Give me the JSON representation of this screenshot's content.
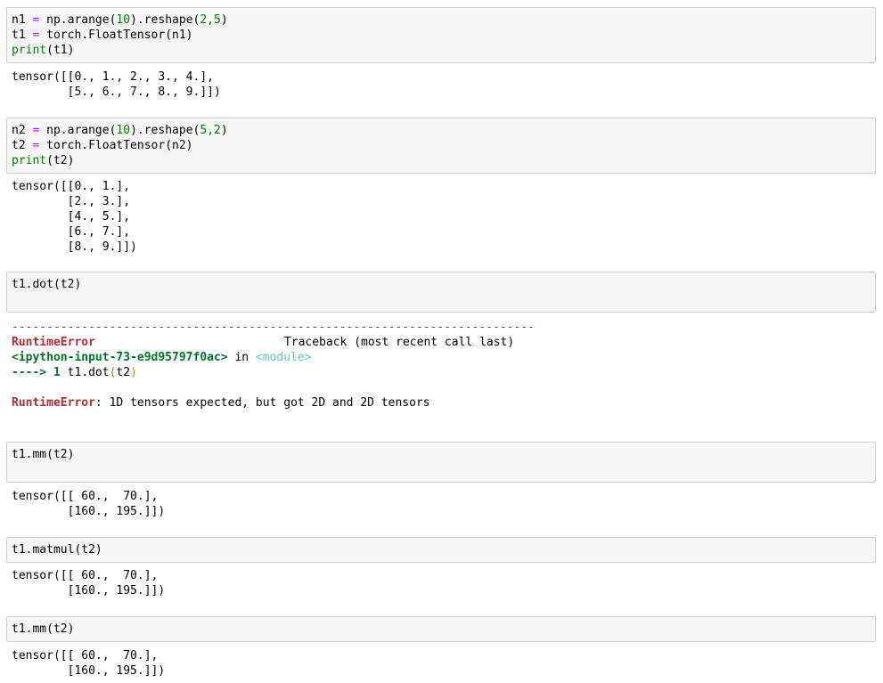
{
  "cells": [
    {
      "input": [
        {
          "a": "n1",
          "op": "=",
          "b": "np.arange(",
          "num1": "10",
          "c": ").reshape(",
          "num2": "2,5",
          "d": ")"
        },
        {
          "a": "t1",
          "op": "=",
          "b": "torch.FloatTensor(n1)"
        },
        {
          "fn": "print",
          "rest": "(t1)"
        }
      ],
      "output": [
        "tensor([[0., 1., 2., 3., 4.],",
        "        [5., 6., 7., 8., 9.]])"
      ]
    },
    {
      "input": [
        {
          "a": "n2",
          "op": "=",
          "b": "np.arange(",
          "num1": "10",
          "c": ").reshape(",
          "num2": "5,2",
          "d": ")"
        },
        {
          "a": "t2",
          "op": "=",
          "b": "torch.FloatTensor(n2)"
        },
        {
          "fn": "print",
          "rest": "(t2)"
        }
      ],
      "output": [
        "tensor([[0., 1.],",
        "        [2., 3.],",
        "        [4., 5.],",
        "        [6., 7.],",
        "        [8., 9.]])"
      ]
    },
    {
      "input": [
        "t1.dot(t2)"
      ],
      "error": {
        "dashes": "---------------------------------------------------------------------------",
        "name": "RuntimeError",
        "traceback_label": "Traceback (most recent call last)",
        "ipython_input": "<ipython-input-73-e9d95797f0ac>",
        "in": "in",
        "module": "<module>",
        "arrow": "----> 1",
        "code_prefix": "t1.dot",
        "code_paren_open": "(",
        "code_arg": "t2",
        "code_paren_close": ")",
        "message_name": "RuntimeError",
        "message": ": 1D tensors expected, but got 2D and 2D tensors"
      }
    },
    {
      "input": [
        "t1.mm(t2)"
      ],
      "output": [
        "tensor([[ 60.,  70.],",
        "        [160., 195.]])"
      ]
    },
    {
      "input": [
        "t1.matmul(t2)"
      ],
      "output": [
        "tensor([[ 60.,  70.],",
        "        [160., 195.]])"
      ]
    },
    {
      "input": [
        "t1.mm(t2)"
      ],
      "output": [
        "tensor([[ 60.,  70.],",
        "        [160., 195.]])"
      ]
    }
  ]
}
